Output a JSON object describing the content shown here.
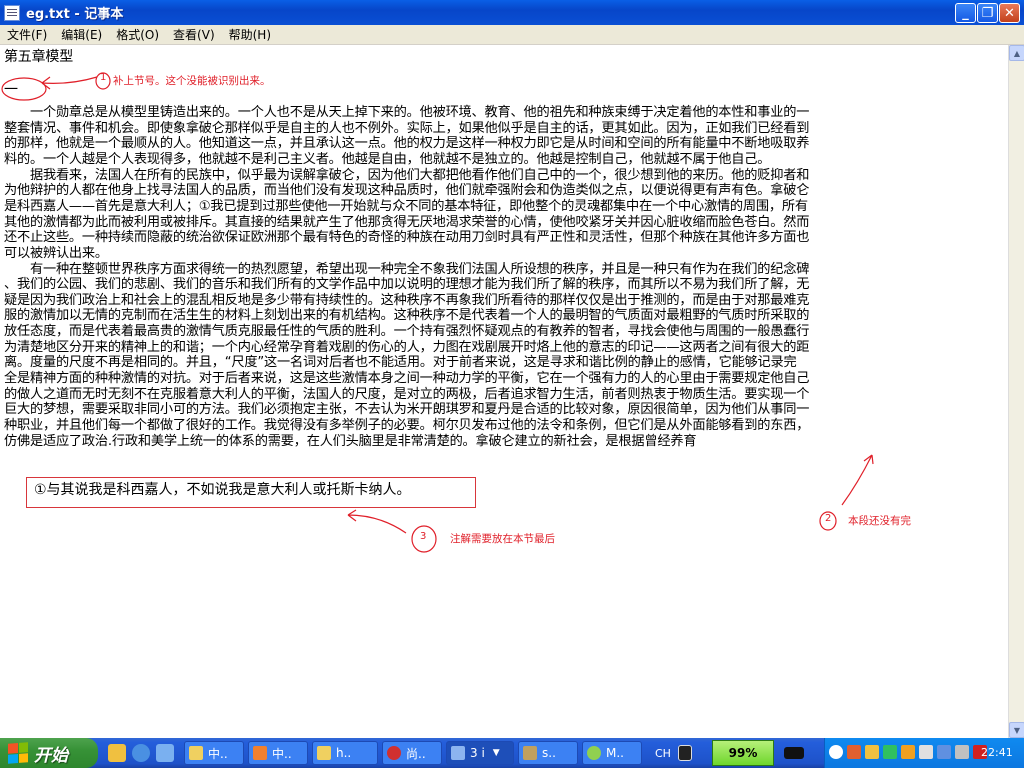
{
  "window": {
    "title": "eg.txt - 记事本",
    "minimize_symbol": "_",
    "maximize_symbol": "❐",
    "close_symbol": "✕"
  },
  "menu": [
    {
      "label": "文件(F)"
    },
    {
      "label": "编辑(E)"
    },
    {
      "label": "格式(O)"
    },
    {
      "label": "查看(V)"
    },
    {
      "label": "帮助(H)"
    }
  ],
  "document": {
    "chapter_title": "第五章模型",
    "section_mark": "一",
    "lines": [
      "　　一个勋章总是从模型里铸造出来的。一个人也不是从天上掉下来的。他被环境、教育、他的祖先和种族束缚于决定着他的本性和事业的一",
      "整套情况、事件和机会。即使象拿破仑那样似乎是自主的人也不例外。实际上，如果他似乎是自主的话，更其如此。因为，正如我们已经看到",
      "的那样，他就是一个最顺从的人。他知道这一点，并且承认这一点。他的权力是这样一种权力即它是从时间和空间的所有能量中不断地吸取养",
      "料的。一个人越是个人表现得多，他就越不是利己主义者。他越是自由，他就越不是独立的。他越是控制自己，他就越不属于他自己。",
      "　　据我看来，法国人在所有的民族中，似乎最为误解拿破仑，因为他们大都把他看作他们自己中的一个，很少想到他的来历。他的贬抑者和",
      "为他辩护的人都在他身上找寻法国人的品质，而当他们没有发现这种品质时，他们就牵强附会和伪造类似之点，以便说得更有声有色。拿破仑",
      "是科西嘉人——首先是意大利人；①我已提到过那些使他一开始就与众不同的基本特征，即他整个的灵魂都集中在一个中心激情的周围，所有",
      "其他的激情都为此而被利用或被排斥。其直接的结果就产生了他那贪得无厌地渴求荣誉的心情，使他咬紧牙关并因心脏收缩而脸色苍白。然而",
      "还不止这些。一种持续而隐蔽的统治欲保证欧洲那个最有特色的奇怪的种族在动用刀剑时具有严正性和灵活性，但那个种族在其他许多方面也",
      "可以被辨认出来。",
      "　　有一种在整顿世界秩序方面求得统一的热烈愿望，希望出现一种完全不象我们法国人所设想的秩序，并且是一种只有作为在我们的纪念碑",
      "、我们的公园、我们的悲剧、我们的音乐和我们所有的文学作品中加以说明的理想才能为我们所了解的秩序，而其所以不易为我们所了解，无",
      "疑是因为我们政治上和社会上的混乱相反地是多少带有持续性的。这种秩序不再象我们所看待的那样仅仅是出于推测的，而是由于对那最难克",
      "服的激情加以无情的克制而在活生生的材料上刻划出来的有机结构。这种秩序不是代表着一个人的最明智的气质面对最粗野的气质时所采取的",
      "放任态度，而是代表着最高贵的激情气质克服最任性的气质的胜利。一个持有强烈怀疑观点的有教养的智者，寻找会使他与周围的一般愚蠢行",
      "为清楚地区分开来的精神上的和谐；一个内心经常孕育着戏剧的伤心的人，力图在戏剧展开时烙上他的意志的印记——这两者之间有很大的距",
      "离。度量的尺度不再是相同的。并且，“尺度”这一名词对后者也不能适用。对于前者来说，这是寻求和谐比例的静止的感情，它能够记录完",
      "全是精神方面的种种激情的对抗。对于后者来说，这是这些激情本身之间一种动力学的平衡，它在一个强有力的人的心里由于需要规定他自己",
      "的做人之道而无时无刻不在克服着意大利人的平衡，法国人的尺度，是对立的两极，后者追求智力生活，前者则热衷于物质生活。要实现一个",
      "巨大的梦想，需要采取非同小可的方法。我们必须抱定主张，不去认为米开朗琪罗和夏丹是合适的比较对象，原因很简单，因为他们从事同一",
      "种职业，并且他们每一个都做了很好的工作。我觉得没有多举例子的必要。柯尔贝发布过他的法令和条例，但它们是从外面能够看到的东西，",
      "仿佛是适应了政治.行政和美学上统一的体系的需要，在人们头脑里是非常清楚的。拿破仑建立的新社会，是根据曾经养育"
    ],
    "footnote": "①与其说我是科西嘉人，不如说我是意大利人或托斯卡纳人。"
  },
  "annotations": {
    "note1_num": "1",
    "note1": "补上节号。这个没能被识别出来。",
    "note2_num": "2",
    "note2": "本段还没有完",
    "note3_num": "3",
    "note3": "注解需要放在本节最后"
  },
  "taskbar": {
    "start_label": "开始",
    "tasks": [
      {
        "label": "中.."
      },
      {
        "label": "中.."
      },
      {
        "label": "h.."
      },
      {
        "label": "尚.."
      },
      {
        "label": "3 i"
      },
      {
        "label": "s.."
      },
      {
        "label": "M.."
      }
    ],
    "lang": "CH",
    "battery": "99%",
    "clock": "22:41"
  },
  "colors": {
    "annotation": "#e0202a",
    "title_bar": "#0a5fe6",
    "taskbar": "#245edb",
    "start": "#379237"
  }
}
